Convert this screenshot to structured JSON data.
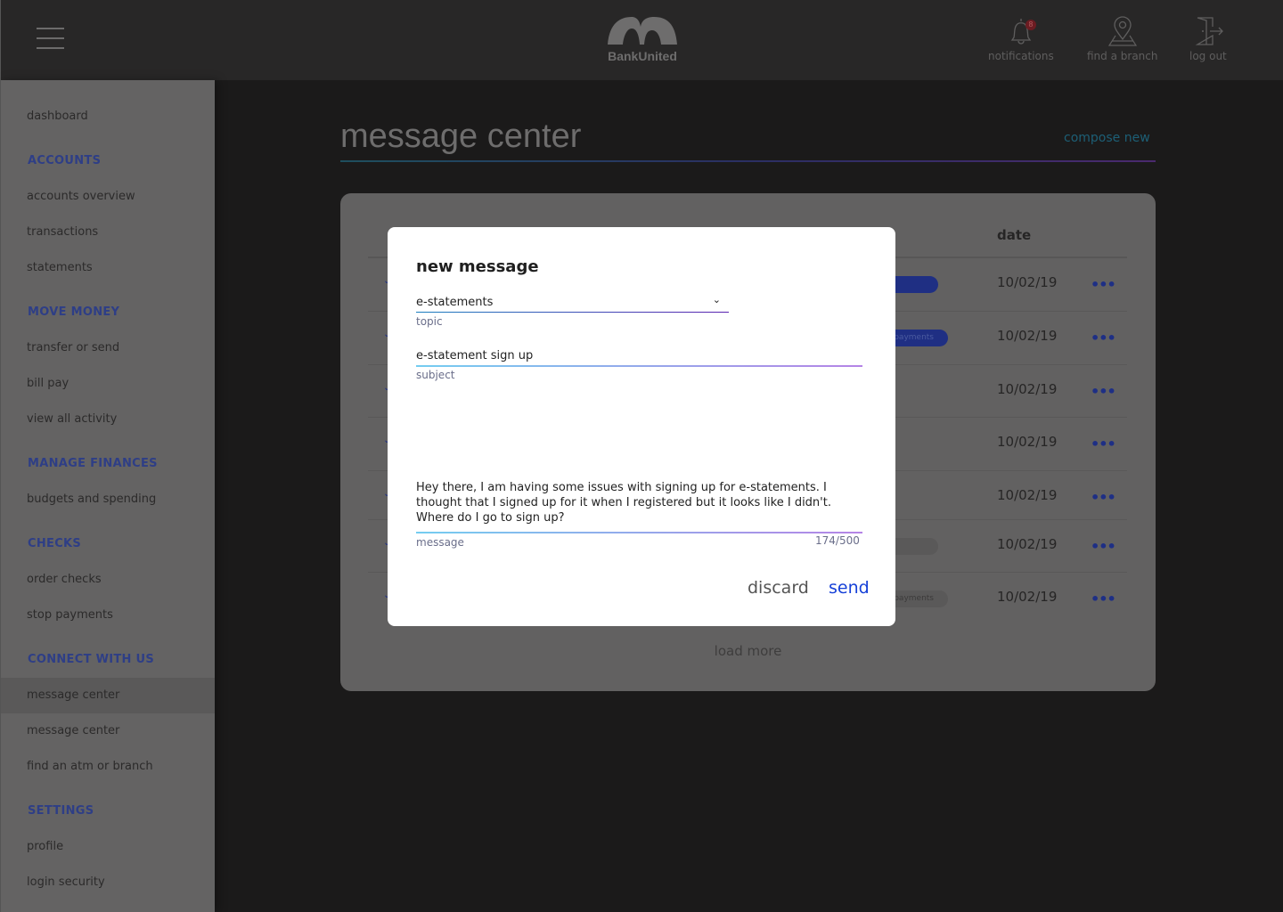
{
  "header": {
    "logo_text": "BankUnited",
    "notifications_label": "notifications",
    "notifications_count": "8",
    "branch_label": "find a branch",
    "logout_label": "log out"
  },
  "sidebar": {
    "dashboard": "dashboard",
    "sections": [
      {
        "title": "ACCOUNTS",
        "items": [
          "accounts overview",
          "transactions",
          "statements"
        ]
      },
      {
        "title": "MOVE MONEY",
        "items": [
          "transfer or send",
          "bill pay",
          "view all activity"
        ]
      },
      {
        "title": "MANAGE FINANCES",
        "items": [
          "budgets and spending"
        ]
      },
      {
        "title": "CHECKS",
        "items": [
          "order checks",
          "stop payments"
        ]
      },
      {
        "title": "CONNECT WITH US",
        "items": [
          "message center",
          "message center",
          "find an atm or branch"
        ]
      },
      {
        "title": "SETTINGS",
        "items": [
          "profile",
          "login security"
        ]
      }
    ]
  },
  "page": {
    "title": "message center",
    "compose": "compose new"
  },
  "table": {
    "date_header": "date",
    "rows": [
      {
        "date": "10/02/19",
        "tag": ""
      },
      {
        "date": "10/02/19",
        "tag": "ng & payments"
      },
      {
        "date": "10/02/19",
        "tag": ""
      },
      {
        "date": "10/02/19",
        "tag": ""
      },
      {
        "date": "10/02/19",
        "tag": ""
      },
      {
        "date": "10/02/19",
        "tag": ""
      },
      {
        "date": "10/02/19",
        "tag": "ng & payments"
      }
    ],
    "more": "•••",
    "load_more": "load more"
  },
  "modal": {
    "title": "new message",
    "topic_value": "e-statements",
    "topic_label": "topic",
    "subject_value": "e-statement sign up",
    "subject_label": "subject",
    "message_value": "Hey there, I am having some issues with signing up for e-statements. I thought that I signed up for it when I registered but it looks like I didn't. Where do I go to sign up?",
    "message_label": "message",
    "char_count": "174/500",
    "discard": "discard",
    "send": "send"
  }
}
